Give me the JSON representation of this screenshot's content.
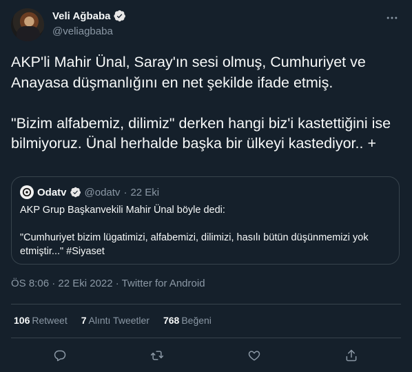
{
  "author": {
    "display_name": "Veli Ağbaba",
    "handle": "@veliagbaba"
  },
  "tweet": {
    "text": "AKP'li Mahir Ünal, Saray'ın sesi olmuş, Cumhuriyet ve Anayasa düşmanlığını en net şekilde ifade etmiş.\n\n\"Bizim alfabemiz, dilimiz\" derken hangi biz'i kastettiğini ise bilmiyoruz. Ünal herhalde başka bir ülkeyi kastediyor.. +",
    "timestamp": "ÖS 8:06 · 22 Eki 2022 · Twitter for Android"
  },
  "quoted": {
    "name": "Odatv",
    "handle": "@odatv",
    "separator": "·",
    "date": "22 Eki",
    "text": "AKP Grup Başkanvekili Mahir Ünal böyle dedi:\n\n\"Cumhuriyet bizim lügatimizi, alfabemizi, dilimizi, hasılı bütün düşünmemizi yok etmiştir...\" #Siyaset"
  },
  "stats": {
    "retweets": {
      "count": "106",
      "label": "Retweet"
    },
    "quotes": {
      "count": "7",
      "label": "Alıntı Tweetler"
    },
    "likes": {
      "count": "768",
      "label": "Beğeni"
    }
  },
  "icons": {
    "more": "more-icon",
    "verified": "verified-badge-icon",
    "reply": "reply-icon",
    "retweet": "retweet-icon",
    "like": "like-icon",
    "share": "share-icon"
  },
  "colors": {
    "background": "#15202b",
    "text": "#f7f9f9",
    "secondary": "#8b98a5",
    "border": "#38444d",
    "verified": "#1d9bf0"
  }
}
